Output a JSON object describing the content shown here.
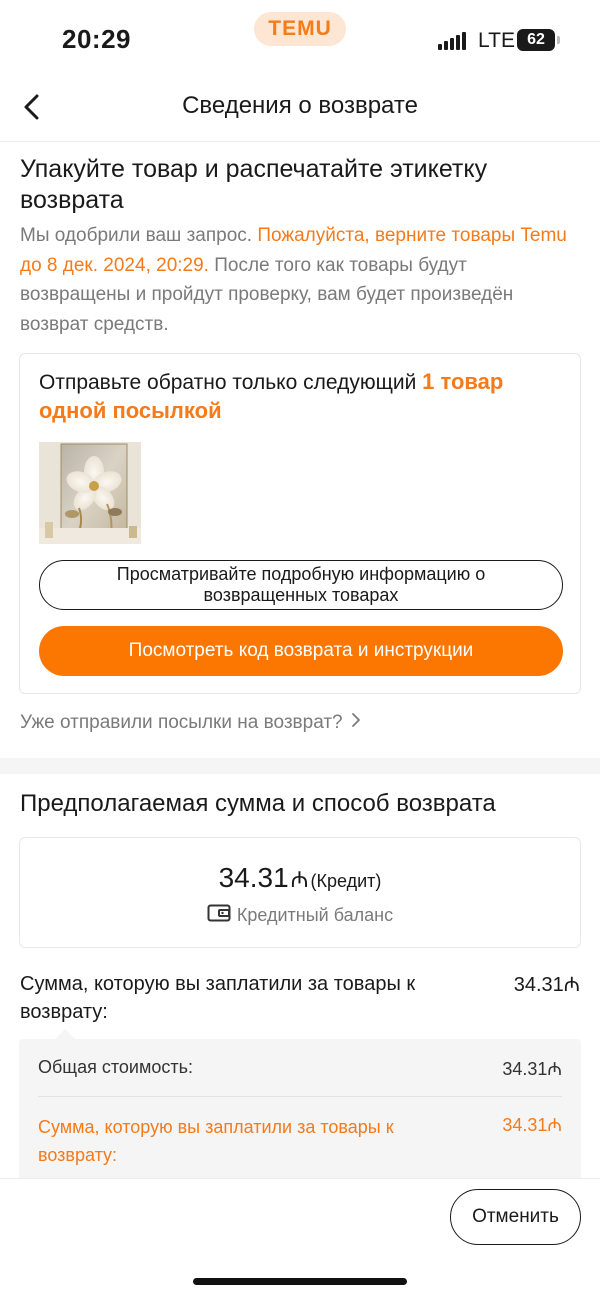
{
  "status_bar": {
    "time": "20:29",
    "brand": "TEMU",
    "network": "LTE",
    "battery": "62"
  },
  "nav": {
    "title": "Сведения о возврате",
    "back_icon": "chevron-left-icon"
  },
  "pack_section": {
    "title": "Упакуйте товар и распечатайте этикетку возврата",
    "desc_part1": "Мы одобрили ваш запрос. ",
    "desc_highlight": "Пожалуйста, верните товары Temu до 8 дек. 2024, 20:29.",
    "desc_part2": " После того как товары будут возвращены и пройдут проверку, вам будет произведён возврат средств."
  },
  "return_card": {
    "heading": "Отправьте обратно только следующий ",
    "heading_highlight": "1 товар одной посылкой",
    "view_details_button": "Просматривайте подробную информацию о возвращенных товарах",
    "view_code_button": "Посмотреть код возврата и инструкции"
  },
  "sent_link": "Уже отправили посылки на возврат?",
  "refund_section": {
    "title": "Предполагаемая сумма и способ возврата",
    "amount": "34.31",
    "currency": "₼",
    "amount_note": "(Кредит)",
    "method": "Кредитный баланс",
    "paid_label": "Сумма, которую вы заплатили за товары к возврату:",
    "paid_value": "34.31₼",
    "breakdown": {
      "total_label": "Общая стоимость:",
      "total_value": "34.31₼",
      "paid_label": "Сумма, которую вы заплатили за товары к возврату:",
      "paid_value": "34.31₼"
    }
  },
  "footer": {
    "cancel_button": "Отменить"
  },
  "colors": {
    "accent": "#fb7701",
    "accent_text": "#f57a1a",
    "muted_text": "#7a7a7a"
  }
}
